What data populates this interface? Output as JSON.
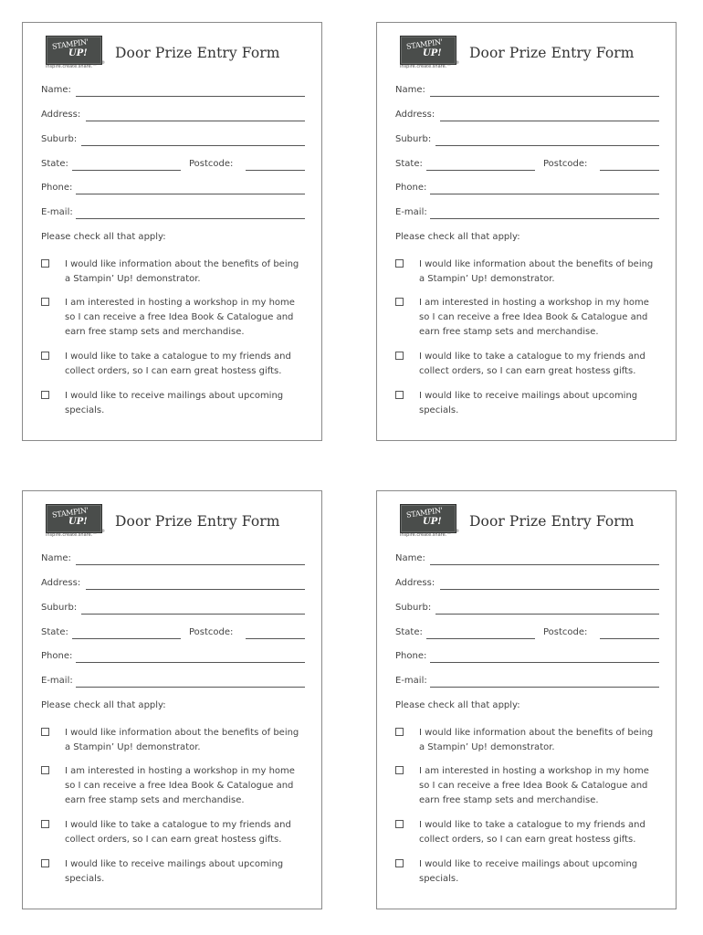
{
  "forms": [
    {
      "logo": {
        "line1": "STAMPIN'",
        "line2": "UP!",
        "reg": "®",
        "tagline": "inspire.create.share.™"
      },
      "title": "Door Prize Entry Form",
      "fields": {
        "name": "Name:",
        "address": "Address:",
        "suburb": "Suburb:",
        "state": "State:",
        "postcode": "Postcode:",
        "phone": "Phone:",
        "email": "E-mail:"
      },
      "check_heading": "Please check all that apply:",
      "options": [
        {
          "label": "I would like information about the benefits of being a Stampin’ Up! demonstrator.",
          "checked": false
        },
        {
          "label": "I am interested in hosting a workshop in my home so I can receive a free Idea Book & Catalogue and earn free stamp sets and merchandise.",
          "checked": false
        },
        {
          "label": "I would like to take a catalogue to my friends and collect orders, so I can earn great hostess gifts.",
          "checked": false
        },
        {
          "label": "I would like to receive mailings about upcoming specials.",
          "checked": false
        }
      ]
    },
    {
      "logo": {
        "line1": "STAMPIN'",
        "line2": "UP!",
        "reg": "®",
        "tagline": "inspire.create.share.™"
      },
      "title": "Door Prize Entry Form",
      "fields": {
        "name": "Name:",
        "address": "Address:",
        "suburb": "Suburb:",
        "state": "State:",
        "postcode": "Postcode:",
        "phone": "Phone:",
        "email": "E-mail:"
      },
      "check_heading": "Please check all that apply:",
      "options": [
        {
          "label": "I would like information about the benefits of being a Stampin’ Up! demonstrator.",
          "checked": false
        },
        {
          "label": "I am interested in hosting a workshop in my home so I can receive a free Idea Book & Catalogue and earn free stamp sets and merchandise.",
          "checked": false
        },
        {
          "label": "I would like to take a catalogue to my friends and collect orders, so I can earn great hostess gifts.",
          "checked": false
        },
        {
          "label": "I would like to receive mailings about upcoming specials.",
          "checked": false
        }
      ]
    },
    {
      "logo": {
        "line1": "STAMPIN'",
        "line2": "UP!",
        "reg": "®",
        "tagline": "inspire.create.share.™"
      },
      "title": "Door Prize Entry Form",
      "fields": {
        "name": "Name:",
        "address": "Address:",
        "suburb": "Suburb:",
        "state": "State:",
        "postcode": "Postcode:",
        "phone": "Phone:",
        "email": "E-mail:"
      },
      "check_heading": "Please check all that apply:",
      "options": [
        {
          "label": "I would like information about the benefits of being a Stampin’ Up! demonstrator.",
          "checked": false
        },
        {
          "label": "I am interested in hosting a workshop in my home so I can receive a free Idea Book & Catalogue and earn free stamp sets and merchandise.",
          "checked": false
        },
        {
          "label": "I would like to take a catalogue to my friends and collect orders, so I can earn great hostess gifts.",
          "checked": false
        },
        {
          "label": "I would like to receive mailings about upcoming specials.",
          "checked": false
        }
      ]
    },
    {
      "logo": {
        "line1": "STAMPIN'",
        "line2": "UP!",
        "reg": "®",
        "tagline": "inspire.create.share.™"
      },
      "title": "Door Prize Entry Form",
      "fields": {
        "name": "Name:",
        "address": "Address:",
        "suburb": "Suburb:",
        "state": "State:",
        "postcode": "Postcode:",
        "phone": "Phone:",
        "email": "E-mail:"
      },
      "check_heading": "Please check all that apply:",
      "options": [
        {
          "label": "I would like information about the benefits of being a Stampin’ Up! demonstrator.",
          "checked": false
        },
        {
          "label": "I am interested in hosting a workshop in my home so I can receive a free Idea Book & Catalogue and earn free stamp sets and merchandise.",
          "checked": false
        },
        {
          "label": "I would like to take a catalogue to my friends and collect orders, so I can earn great hostess gifts.",
          "checked": false
        },
        {
          "label": "I would like to receive mailings about upcoming specials.",
          "checked": false
        }
      ]
    }
  ]
}
